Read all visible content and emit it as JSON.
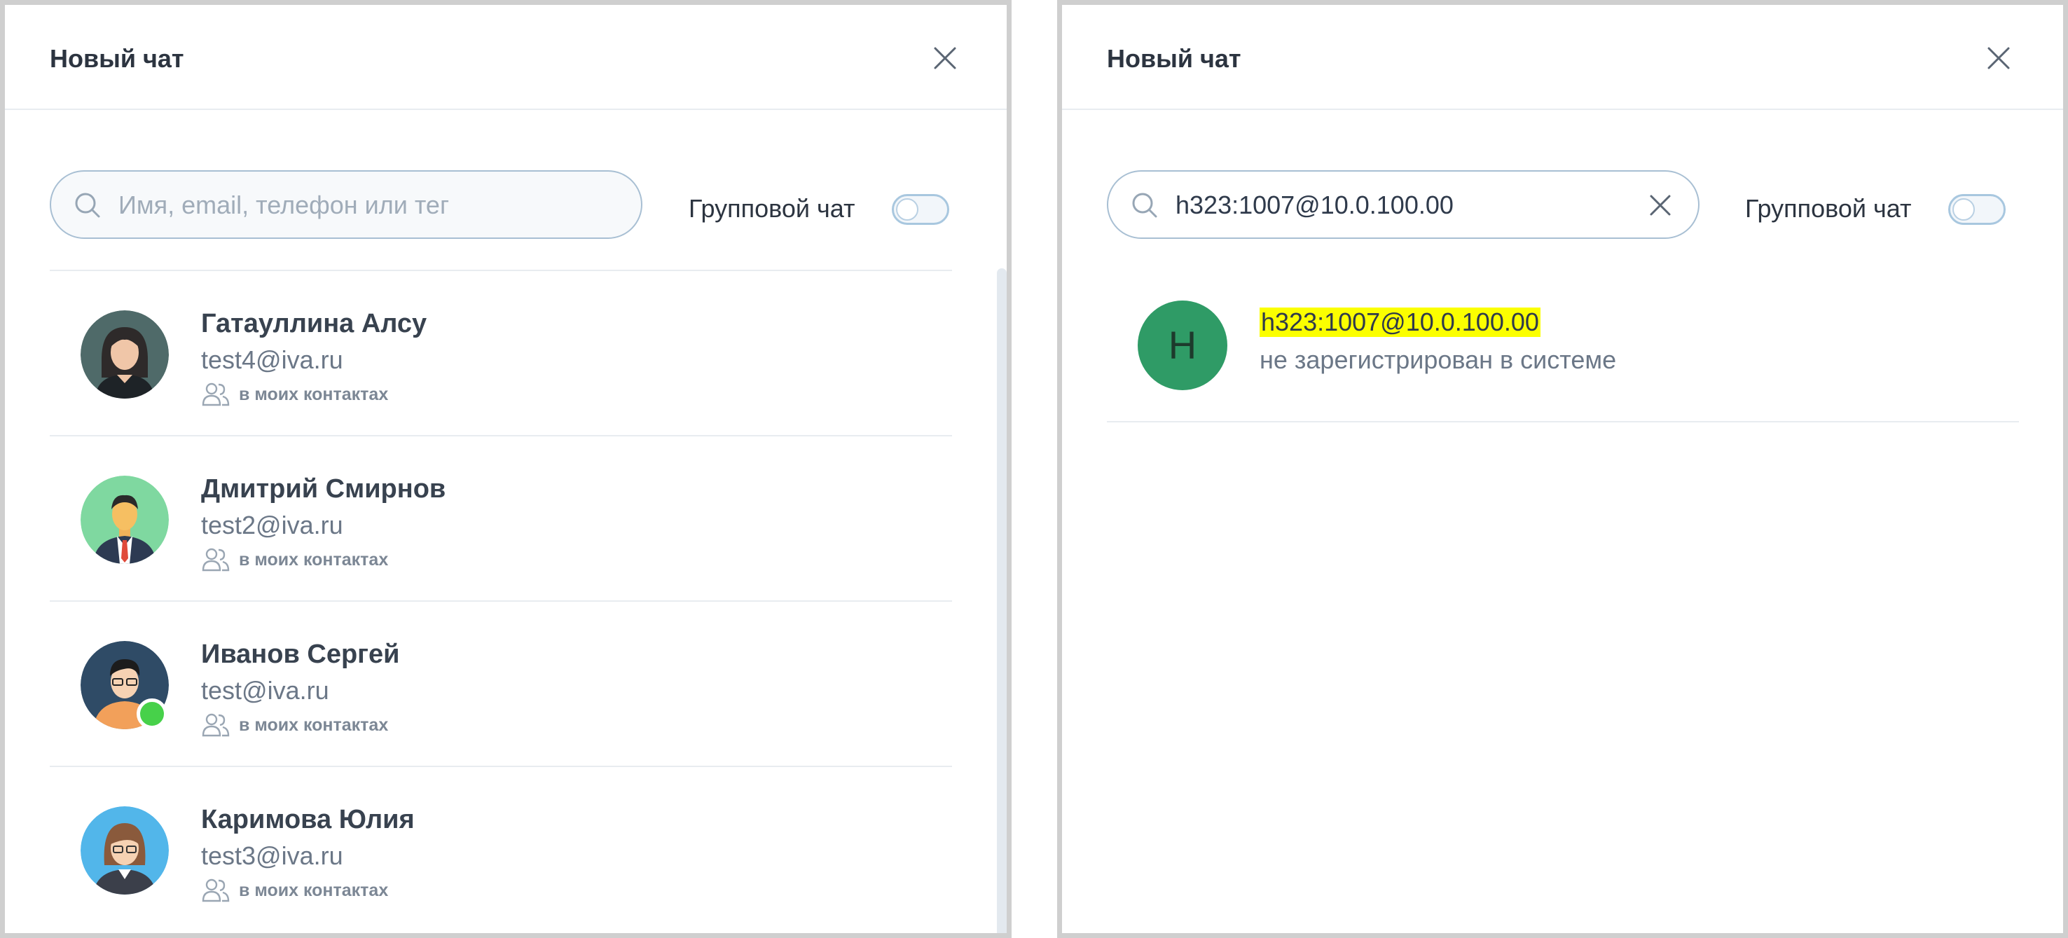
{
  "left_panel": {
    "title": "Новый чат",
    "search": {
      "placeholder": "Имя, email, телефон или тег",
      "value": ""
    },
    "group_chat_label": "Групповой чат",
    "group_chat_enabled": false,
    "contacts": [
      {
        "name": "Гатауллина Алсу",
        "email": "test4@iva.ru",
        "tag": "в моих контактах",
        "avatar": "woman-dark-hair-avatar",
        "online": false
      },
      {
        "name": "Дмитрий Смирнов",
        "email": "test2@iva.ru",
        "tag": "в моих контактах",
        "avatar": "man-suit-avatar",
        "online": false
      },
      {
        "name": "Иванов Сергей",
        "email": "test@iva.ru",
        "tag": "в моих контактах",
        "avatar": "man-glasses-avatar",
        "online": true
      },
      {
        "name": "Каримова Юлия",
        "email": "test3@iva.ru",
        "tag": "в моих контактах",
        "avatar": "woman-glasses-avatar",
        "online": false
      }
    ]
  },
  "right_panel": {
    "title": "Новый чат",
    "search": {
      "placeholder": "",
      "value": "h323:1007@10.0.100.00"
    },
    "group_chat_label": "Групповой чат",
    "group_chat_enabled": false,
    "result": {
      "initial": "H",
      "address": "h323:1007@10.0.100.00",
      "status": "не зарегистрирован в системе",
      "highlight_color": "#fbff00",
      "avatar_color": "#2f9b66"
    }
  },
  "colors": {
    "online": "#47d14a",
    "search_border": "#a8bfd3",
    "divider": "#e8ecf0"
  }
}
